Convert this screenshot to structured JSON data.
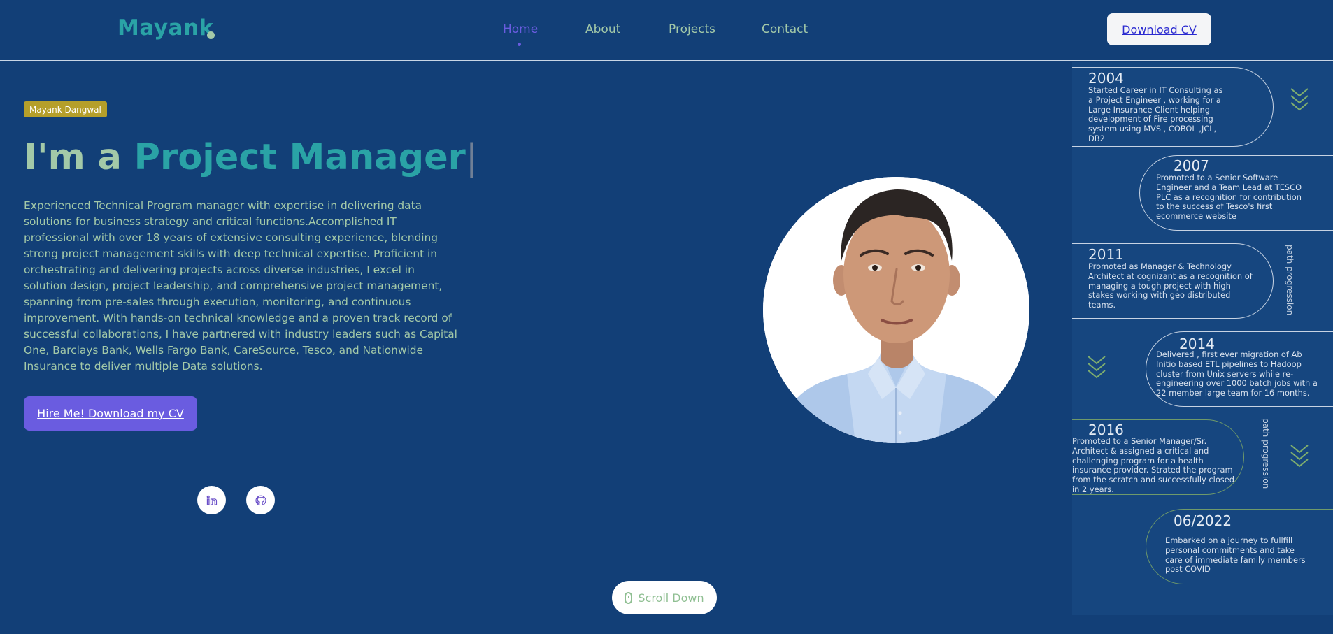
{
  "header": {
    "logo": "Mayank",
    "nav": [
      {
        "label": "Home",
        "active": true
      },
      {
        "label": "About",
        "active": false
      },
      {
        "label": "Projects",
        "active": false
      },
      {
        "label": "Contact",
        "active": false
      }
    ],
    "cv_button": "Download CV"
  },
  "hero": {
    "badge": "Mayank Dangwal",
    "headline_prefix": "I'm a",
    "headline_role": "Project Manager",
    "headline_cursor": "|",
    "intro": "Experienced Technical Program manager with expertise in delivering data solutions for business strategy and critical functions.Accomplished IT professional with over 18 years of extensive consulting experience, blending strong project management skills with deep technical expertise. Proficient in orchestrating and delivering projects across diverse industries, I excel in solution design, project leadership, and comprehensive project management, spanning from pre-sales through execution, monitoring, and continuous improvement. With hands-on technical knowledge and a proven track record of successful collaborations, I have partnered with industry leaders such as Capital One, Barclays Bank, Wells Fargo Bank, CareSource, Tesco, and Nationwide Insurance to deliver multiple Data solutions.",
    "hire_button": "Hire Me! Download my CV",
    "social": [
      {
        "name": "linkedin",
        "icon": "linkedin-icon"
      },
      {
        "name": "github",
        "icon": "github-icon"
      }
    ],
    "scroll_label": "Scroll Down"
  },
  "timeline": {
    "side_label": "path progression",
    "items": [
      {
        "year": "2004",
        "text": "Started Career in IT Consulting as a Project Engineer , working for a Large Insurance Client helping development of Fire processing system using MVS , COBOL ,JCL, DB2"
      },
      {
        "year": "2007",
        "text": "Promoted to a Senior Software Engineer and a Team Lead at TESCO PLC as a recognition for contribution to the success of Tesco's first ecommerce website"
      },
      {
        "year": "2011",
        "text": "Promoted as Manager & Technology Architect at cognizant as a recognition of managing a tough project with high stakes working with geo distributed teams."
      },
      {
        "year": "2014",
        "text": "Delivered , first ever migration of Ab Initio based ETL pipelines to Hadoop cluster from Unix servers while re-engineering over 1000 batch jobs with a 22 member large team for 16 months."
      },
      {
        "year": "2016",
        "text": "Promoted to a Senior Manager/Sr. Architect & assigned a critical and challenging program for a health insurance provider. Strated the program from the scratch and successfully closed in 2 years."
      },
      {
        "year": "06/2022",
        "text": "Embarked on a journey to fullfill personal commitments and take care of immediate family members post COVID"
      }
    ]
  },
  "colors": {
    "background": "#123f77",
    "accent": "#6a5ce0",
    "teal": "#2aa3a6",
    "sage": "#a3c9a8",
    "badge": "#b59f2a"
  }
}
